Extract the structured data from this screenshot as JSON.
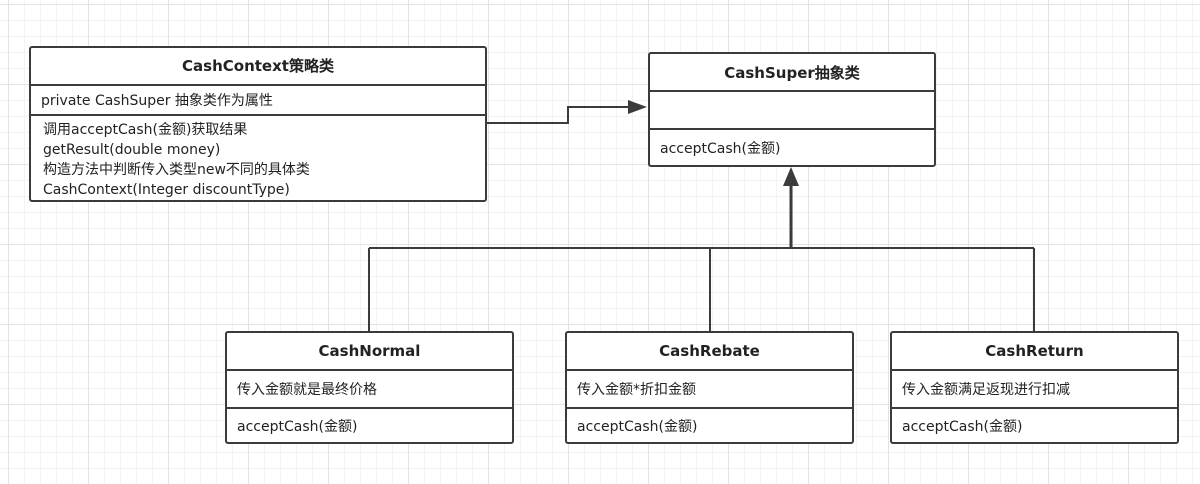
{
  "classes": {
    "cash_context": {
      "name": "CashContext策略类",
      "attributes": [
        "private CashSuper  抽象类作为属性"
      ],
      "operations": [
        "调用acceptCash(金额)获取结果",
        "getResult(double money)",
        "构造方法中判断传入类型new不同的具体类",
        "CashContext(Integer discountType)"
      ]
    },
    "cash_super": {
      "name": "CashSuper抽象类",
      "attributes": [],
      "operations": [
        "acceptCash(金额)"
      ]
    },
    "cash_normal": {
      "name": "CashNormal",
      "attributes": [
        "传入金额就是最终价格"
      ],
      "operations": [
        "acceptCash(金额)"
      ]
    },
    "cash_rebate": {
      "name": "CashRebate",
      "attributes": [
        "传入金额*折扣金额"
      ],
      "operations": [
        "acceptCash(金额)"
      ]
    },
    "cash_return": {
      "name": "CashReturn",
      "attributes": [
        "传入金额满足返现进行扣减"
      ],
      "operations": [
        "acceptCash(金额)"
      ]
    }
  },
  "relations": [
    {
      "type": "association",
      "from": "CashContext策略类",
      "to": "CashSuper抽象类"
    },
    {
      "type": "generalization",
      "from": "CashNormal",
      "to": "CashSuper抽象类"
    },
    {
      "type": "generalization",
      "from": "CashRebate",
      "to": "CashSuper抽象类"
    },
    {
      "type": "generalization",
      "from": "CashReturn",
      "to": "CashSuper抽象类"
    }
  ],
  "colors": {
    "line": "#3b3b3b",
    "grid": "#e3e3e3",
    "background": "#ffffff"
  }
}
